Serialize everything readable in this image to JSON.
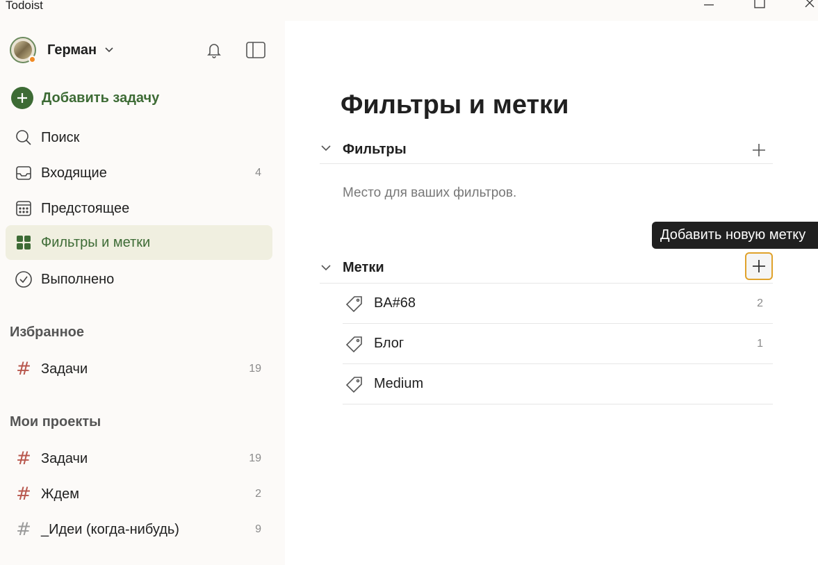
{
  "window": {
    "title": "Todoist"
  },
  "sidebar": {
    "user": {
      "name": "Герман",
      "status_color": "#f08a24"
    },
    "add_task_label": "Добавить задачу",
    "accent_color": "#3d6b35",
    "nav": [
      {
        "label": "Поиск",
        "icon": "search-icon",
        "count": ""
      },
      {
        "label": "Входящие",
        "icon": "inbox-icon",
        "count": "4"
      },
      {
        "label": "Предстоящее",
        "icon": "calendar-icon",
        "count": ""
      },
      {
        "label": "Фильтры и метки",
        "icon": "filters-grid-icon",
        "count": "",
        "active": true
      },
      {
        "label": "Выполнено",
        "icon": "check-circle-icon",
        "count": ""
      }
    ],
    "favorites": {
      "title": "Избранное",
      "items": [
        {
          "label": "Задачи",
          "count": "19",
          "color": "#b8574d"
        }
      ]
    },
    "projects": {
      "title": "Мои проекты",
      "items": [
        {
          "label": "Задачи",
          "count": "19",
          "color": "#b8574d"
        },
        {
          "label": "Ждем",
          "count": "2",
          "color": "#b8574d"
        },
        {
          "label": "_Идеи (когда-нибудь)",
          "count": "9",
          "color": "#9a9a9a"
        }
      ]
    }
  },
  "main": {
    "title": "Фильтры и метки",
    "filters": {
      "heading": "Фильтры",
      "empty_text": "Место для ваших фильтров."
    },
    "labels": {
      "heading": "Метки",
      "items": [
        {
          "name": "BA#68",
          "count": "2"
        },
        {
          "name": "Блог",
          "count": "1"
        },
        {
          "name": "Medium",
          "count": ""
        }
      ]
    },
    "tooltip": "Добавить новую метку"
  }
}
